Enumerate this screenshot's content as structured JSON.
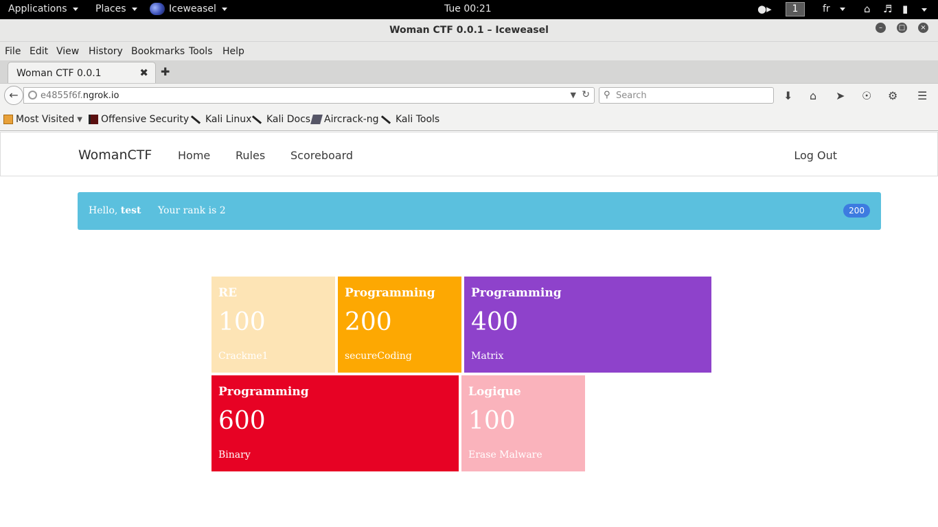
{
  "topbar": {
    "applications": "Applications",
    "places": "Places",
    "app_name": "Iceweasel",
    "clock": "Tue 00:21",
    "workspace": "1",
    "lang": "fr"
  },
  "window": {
    "title": "Woman CTF 0.0.1 – Iceweasel"
  },
  "menu": [
    "File",
    "Edit",
    "View",
    "History",
    "Bookmarks",
    "Tools",
    "Help"
  ],
  "tab": {
    "label": "Woman CTF 0.0.1"
  },
  "nav": {
    "url_prefix": "e4855f6f.",
    "url_host": "ngrok.io",
    "search_placeholder": "Search"
  },
  "bookmarks": [
    "Most Visited",
    "Offensive Security",
    "Kali Linux",
    "Kali Docs",
    "Aircrack-ng",
    "Kali Tools"
  ],
  "site": {
    "brand": "WomanCTF",
    "links": [
      "Home",
      "Rules",
      "Scoreboard"
    ],
    "logout": "Log Out"
  },
  "alert": {
    "hello_prefix": "Hello,",
    "username": "test",
    "rank_text": "Your rank is 2",
    "score": "200"
  },
  "colors": {
    "alert_bg": "#5bc0de",
    "badge_bg": "#3d7be0"
  },
  "challenges": [
    {
      "category": "RE",
      "points": "100",
      "name": "Crackme1",
      "color": "#fde4b5"
    },
    {
      "category": "Programming",
      "points": "200",
      "name": "secureCoding",
      "color": "#fda802"
    },
    {
      "category": "Programming",
      "points": "400",
      "name": "Matrix",
      "color": "#8e42cb"
    },
    {
      "category": "Programming",
      "points": "600",
      "name": "Binary",
      "color": "#e70224"
    },
    {
      "category": "Logique",
      "points": "100",
      "name": "Erase Malware",
      "color": "#fab3bc"
    }
  ]
}
